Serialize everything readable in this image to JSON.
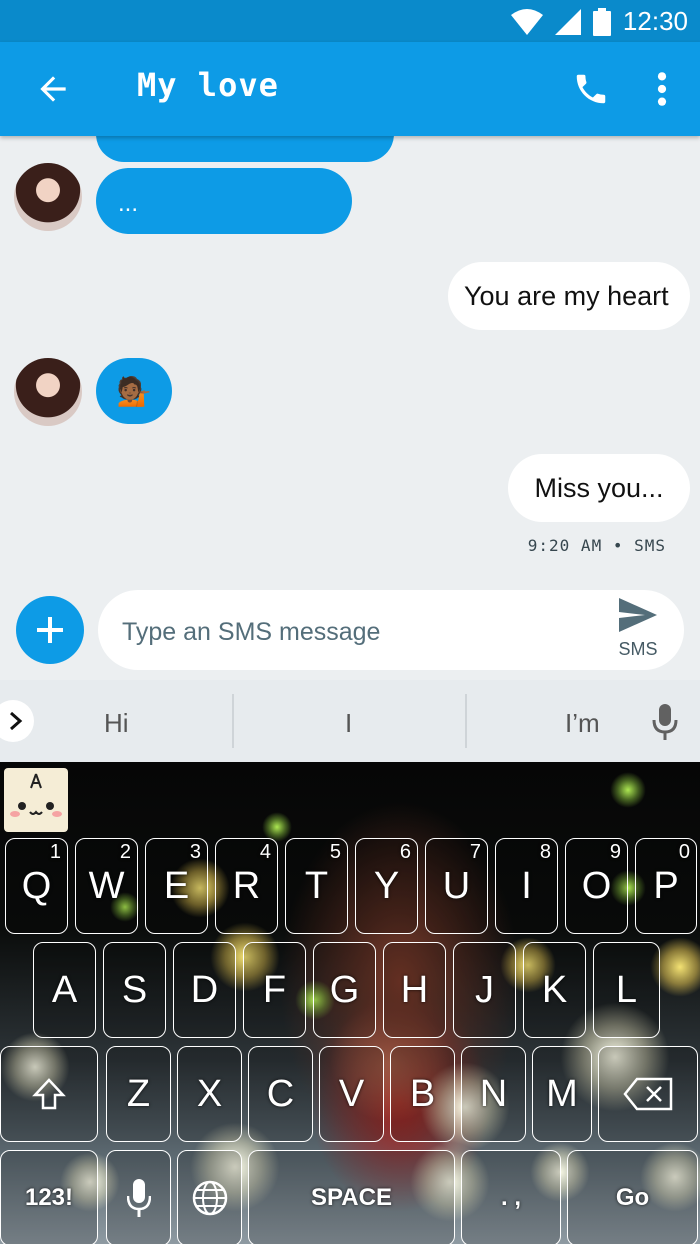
{
  "status_bar": {
    "time": "12:30"
  },
  "app_bar": {
    "title": "My love"
  },
  "messages": {
    "incoming_partial": "...",
    "outgoing_1": "You are my heart",
    "emoji": "💁🏾",
    "outgoing_2": "Miss you...",
    "timestamp": "9:20 AM • SMS"
  },
  "compose": {
    "placeholder": "Type an SMS message",
    "send_label": "SMS"
  },
  "suggestions": [
    "Hi",
    "I",
    "I’m"
  ],
  "keyboard": {
    "row1": [
      {
        "label": "Q",
        "hint": "1"
      },
      {
        "label": "W",
        "hint": "2"
      },
      {
        "label": "E",
        "hint": "3"
      },
      {
        "label": "R",
        "hint": "4"
      },
      {
        "label": "T",
        "hint": "5"
      },
      {
        "label": "Y",
        "hint": "6"
      },
      {
        "label": "U",
        "hint": "7"
      },
      {
        "label": "I",
        "hint": "8"
      },
      {
        "label": "O",
        "hint": "9"
      },
      {
        "label": "P",
        "hint": "0"
      }
    ],
    "row2": [
      "A",
      "S",
      "D",
      "F",
      "G",
      "H",
      "J",
      "K",
      "L"
    ],
    "row3": [
      "Z",
      "X",
      "C",
      "V",
      "B",
      "N",
      "M"
    ],
    "symbols_label": "123!",
    "space_label": "SPACE",
    "punct_label": ". ,",
    "go_label": "Go"
  },
  "colors": {
    "primary": "#0d9be6",
    "status_bar": "#0a8acb",
    "background": "#eceff1"
  }
}
